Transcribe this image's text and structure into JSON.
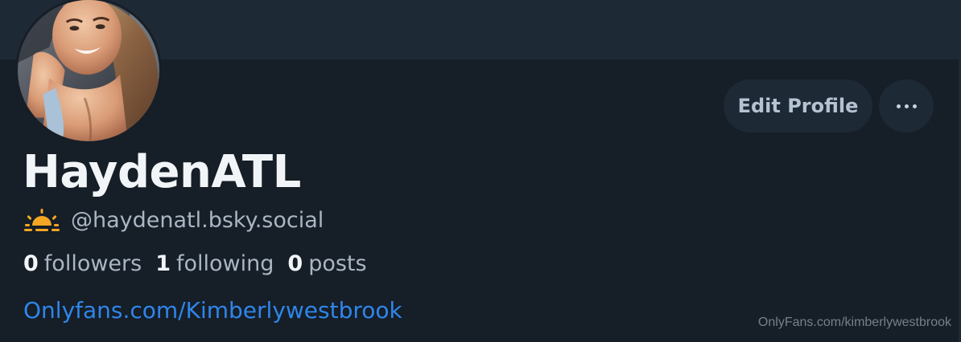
{
  "profile": {
    "display_name": "HaydenATL",
    "handle": "@haydenatl.bsky.social",
    "avatar_icon": "profile-photo",
    "handle_emoji_icon": "sun-icon"
  },
  "actions": {
    "edit_profile_label": "Edit Profile",
    "more_icon": "more-options-icon"
  },
  "stats": [
    {
      "count": "0",
      "label": "followers"
    },
    {
      "count": "1",
      "label": "following"
    },
    {
      "count": "0",
      "label": "posts"
    }
  ],
  "bio": {
    "link_text": "Onlyfans.com/Kimberlywestbrook"
  },
  "watermark": "OnlyFans.com/kimberlywestbrook",
  "colors": {
    "background": "#161e27",
    "banner": "#1e2936",
    "link": "#2f86ea",
    "button_bg": "#1e2936"
  }
}
